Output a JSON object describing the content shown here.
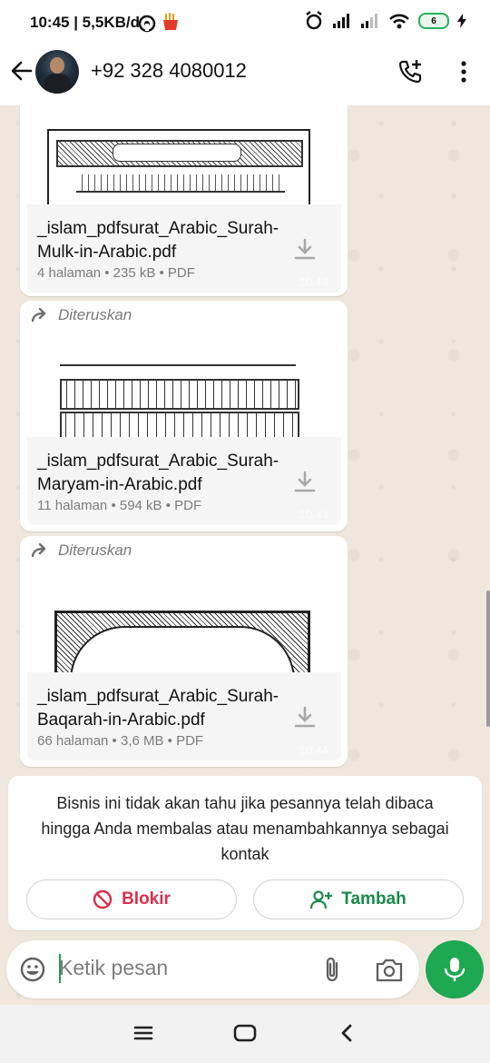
{
  "status_bar": {
    "time": "10:45 | 5,5KB/d",
    "battery": "6"
  },
  "header": {
    "contact": "+92 328 4080012"
  },
  "messages": [
    {
      "forwarded": false,
      "file_name": "_islam_pdfsurat_Arabic_Surah-Mulk-in-Arabic.pdf",
      "meta": "4 halaman • 235 kB • PDF",
      "time": "10.44"
    },
    {
      "forwarded": true,
      "forwarded_label": "Diteruskan",
      "file_name": "_islam_pdfsurat_Arabic_Surah-Maryam-in-Arabic.pdf",
      "meta": "11 halaman • 594 kB • PDF",
      "time": "10.44"
    },
    {
      "forwarded": true,
      "forwarded_label": "Diteruskan",
      "file_name": "_islam_pdfsurat_Arabic_Surah-Baqarah-in-Arabic.pdf",
      "meta": "66 halaman • 3,6 MB • PDF",
      "time": "10.44"
    }
  ],
  "notice": {
    "text": "Bisnis ini tidak akan tahu jika pesannya telah dibaca hingga Anda membalas atau menambahkannya sebagai kontak",
    "block_label": "Blokir",
    "add_label": "Tambah",
    "block_color": "#d9304c",
    "add_color": "#1a8a4a"
  },
  "input": {
    "placeholder": "Ketik pesan"
  },
  "colors": {
    "accent": "#1da851"
  }
}
